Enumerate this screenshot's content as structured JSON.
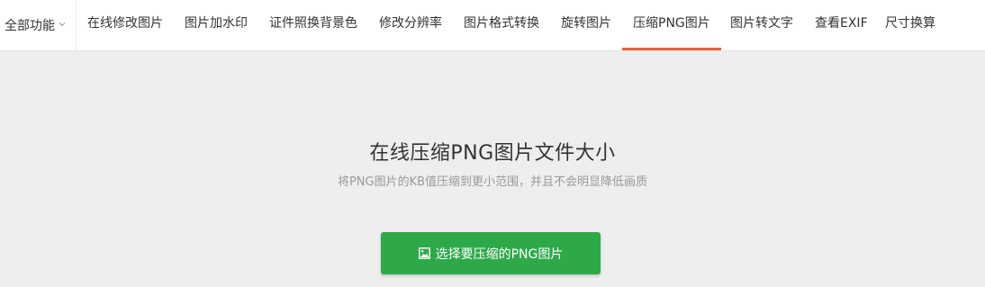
{
  "nav": {
    "all_label": "全部功能",
    "items": [
      {
        "label": "在线修改图片"
      },
      {
        "label": "图片加水印"
      },
      {
        "label": "证件照换背景色"
      },
      {
        "label": "修改分辨率"
      },
      {
        "label": "图片格式转换"
      },
      {
        "label": "旋转图片"
      },
      {
        "label": "压缩PNG图片",
        "active": true
      },
      {
        "label": "图片转文字"
      },
      {
        "label": "查看EXIF"
      },
      {
        "label": "尺寸换算"
      }
    ]
  },
  "hero": {
    "title": "在线压缩PNG图片文件大小",
    "subtitle": "将PNG图片的KB值压缩到更小范围，并且不会明显降低画质",
    "button_label": "选择要压缩的PNG图片"
  },
  "colors": {
    "accent": "#e8603c",
    "button_bg": "#2ea94a",
    "page_bg": "#eeeeee"
  },
  "icons": {
    "all_funcs": "chevron-down-icon",
    "button": "image-icon"
  }
}
